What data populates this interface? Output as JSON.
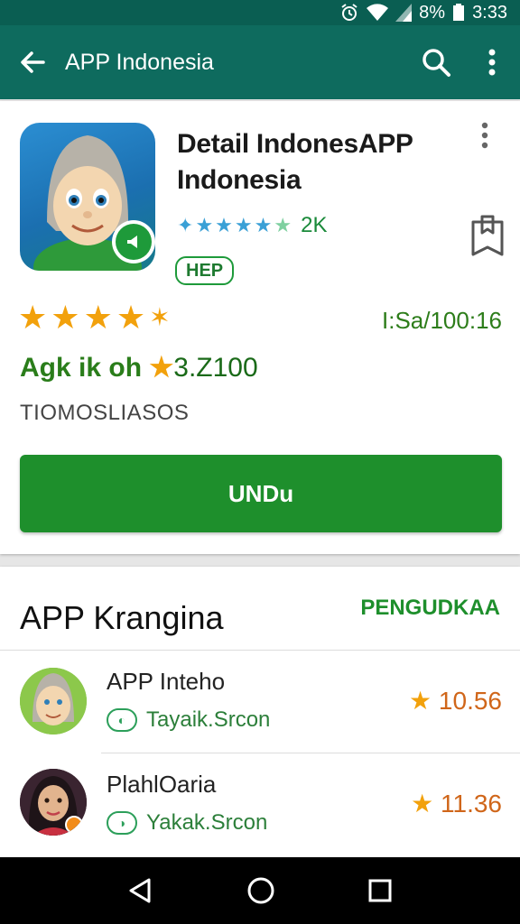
{
  "status": {
    "battery": "8%",
    "time": "3:33"
  },
  "appbar": {
    "title": "APP Indonesia"
  },
  "detail": {
    "title": "Detail IndonesAPP Indonesia",
    "mini_rating_count": "2K",
    "tag": "HEP",
    "ratio": "I:Sa/100:16",
    "rating_label": "Agk ik oh",
    "rating_value": "3.Z100",
    "category": "TIOMOSLIASOS",
    "install_label": "UNDu"
  },
  "list": {
    "header": "APP Krangina",
    "link": "PENGUDKAA",
    "items": [
      {
        "name": "APP Inteho",
        "sub": "Tayaik.Srcon",
        "score": "10.56"
      },
      {
        "name": "PlahlOaria",
        "sub": "Yakak.Srcon",
        "score": "11.36"
      }
    ]
  },
  "colors": {
    "primary": "#0e6b5e",
    "accent": "#1e8f2c",
    "star": "#f2a10c"
  },
  "icons": [
    "back-arrow-icon",
    "search-icon",
    "more-vert-icon",
    "bookmark-icon",
    "alarm-icon",
    "wifi-icon",
    "signal-icon",
    "battery-icon",
    "back-nav-icon",
    "home-nav-icon",
    "recents-nav-icon"
  ]
}
